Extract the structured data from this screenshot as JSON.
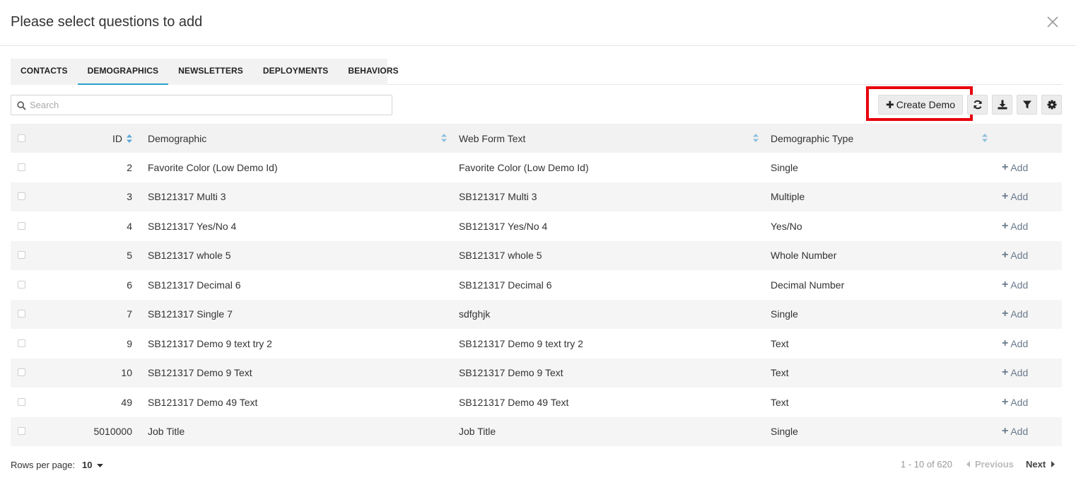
{
  "modal": {
    "title": "Please select questions to add"
  },
  "tabs": [
    {
      "label": "CONTACTS",
      "active": false
    },
    {
      "label": "DEMOGRAPHICS",
      "active": true
    },
    {
      "label": "NEWSLETTERS",
      "active": false
    },
    {
      "label": "DEPLOYMENTS",
      "active": false
    },
    {
      "label": "BEHAVIORS",
      "active": false
    }
  ],
  "search": {
    "placeholder": "Search",
    "value": ""
  },
  "toolbar": {
    "create_label": "Create Demo",
    "buttons": [
      "refresh-icon",
      "download-icon",
      "filter-icon",
      "gear-icon"
    ],
    "highlight_color": "#e8000b"
  },
  "grid": {
    "columns": [
      "ID",
      "Demographic",
      "Web Form Text",
      "Demographic Type"
    ],
    "add_label": "Add",
    "rows": [
      {
        "id": "2",
        "demographic": "Favorite Color (Low Demo Id)",
        "web_form_text": "Favorite Color (Low Demo Id)",
        "type": "Single"
      },
      {
        "id": "3",
        "demographic": "SB121317 Multi 3",
        "web_form_text": "SB121317 Multi 3",
        "type": "Multiple"
      },
      {
        "id": "4",
        "demographic": "SB121317 Yes/No 4",
        "web_form_text": "SB121317 Yes/No 4",
        "type": "Yes/No"
      },
      {
        "id": "5",
        "demographic": "SB121317 whole 5",
        "web_form_text": "SB121317 whole 5",
        "type": "Whole Number"
      },
      {
        "id": "6",
        "demographic": "SB121317 Decimal 6",
        "web_form_text": "SB121317 Decimal 6",
        "type": "Decimal Number"
      },
      {
        "id": "7",
        "demographic": "SB121317 Single 7",
        "web_form_text": "sdfghjk",
        "type": "Single"
      },
      {
        "id": "9",
        "demographic": "SB121317 Demo 9 text try 2",
        "web_form_text": "SB121317 Demo 9 text try 2",
        "type": "Text"
      },
      {
        "id": "10",
        "demographic": "SB121317 Demo 9 Text",
        "web_form_text": "SB121317 Demo 9 Text",
        "type": "Text"
      },
      {
        "id": "49",
        "demographic": "SB121317 Demo 49 Text",
        "web_form_text": "SB121317 Demo 49 Text",
        "type": "Text"
      },
      {
        "id": "5010000",
        "demographic": "Job Title",
        "web_form_text": "Job Title",
        "type": "Single"
      }
    ]
  },
  "footer": {
    "rows_per_page_label": "Rows per page:",
    "rows_per_page_value": "10",
    "range": "1 - 10 of 620",
    "previous": "Previous",
    "next": "Next"
  },
  "colors": {
    "accent": "#27a3cc",
    "sort_icon": "#5aa8d6",
    "add_text": "#6b7a8d"
  }
}
